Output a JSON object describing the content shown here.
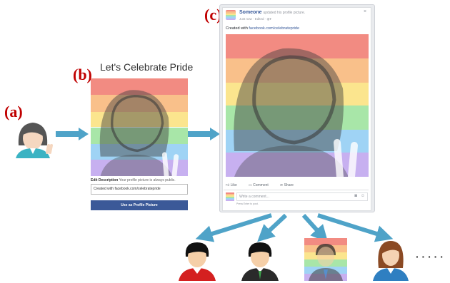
{
  "labels": {
    "a": "(a)",
    "b": "(b)",
    "c": "(c)"
  },
  "profile_tool": {
    "title": "Let's Celebrate Pride",
    "edit_description_label": "Edit Description",
    "edit_description_hint": "Your profile picture is always public.",
    "caption_value": "Created with facebook.com/celebratepride",
    "button_label": "Use as Profile Picture"
  },
  "post": {
    "author": "Someone",
    "action_text": "updated his profile picture.",
    "meta": "Just now · Edited · ",
    "created_with_prefix": "Created with ",
    "created_with_link": "facebook.com/celebratepride",
    "actions": {
      "like": "Like",
      "comment": "Comment",
      "share": "Share"
    },
    "comment_placeholder": "Write a comment...",
    "press_enter_hint": "Press Enter to post."
  },
  "ellipsis": "· · · · ·",
  "colors": {
    "arrow": "#4fa3c8",
    "label": "#c00000",
    "facebook_blue": "#3b5998",
    "rainbow": [
      "#f28b82",
      "#f9c08a",
      "#fbe58e",
      "#a8e6a8",
      "#9fd3f5",
      "#c7b0f0"
    ]
  },
  "icons": [
    "globe-icon",
    "camera-icon",
    "smiley-icon",
    "thumbs-up-icon",
    "comment-icon",
    "share-icon",
    "close-icon"
  ]
}
